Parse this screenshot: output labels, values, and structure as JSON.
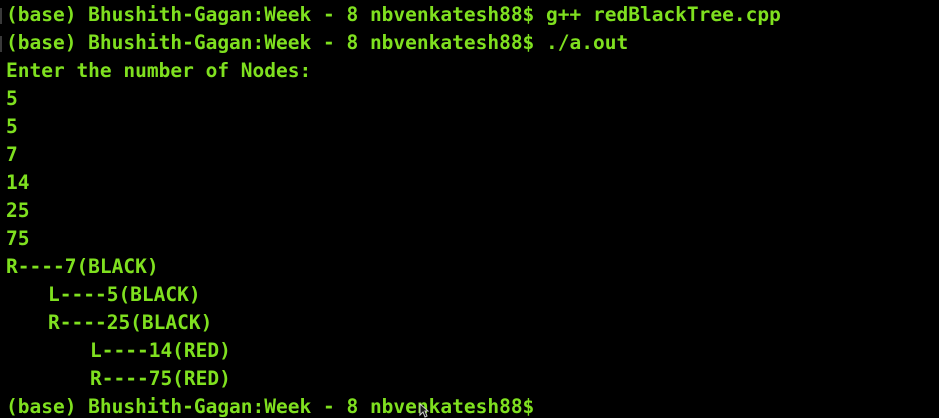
{
  "terminal": {
    "colors": {
      "background": "#000000",
      "text": "#7fe01f"
    },
    "lines": [
      "(base) Bhushith-Gagan:Week - 8 nbvenkatesh88$ g++ redBlackTree.cpp",
      "(base) Bhushith-Gagan:Week - 8 nbvenkatesh88$ ./a.out",
      "Enter the number of Nodes:",
      "5",
      "5",
      "7",
      "14",
      "25",
      "75",
      "R----7(BLACK)",
      "L----5(BLACK)",
      "R----25(BLACK)",
      "L----14(RED)",
      "R----75(RED)",
      "(base) Bhushith-Gagan:Week - 8 nbvenkatesh88$"
    ],
    "icons": {
      "cursor": "mouse-pointer-icon"
    }
  }
}
